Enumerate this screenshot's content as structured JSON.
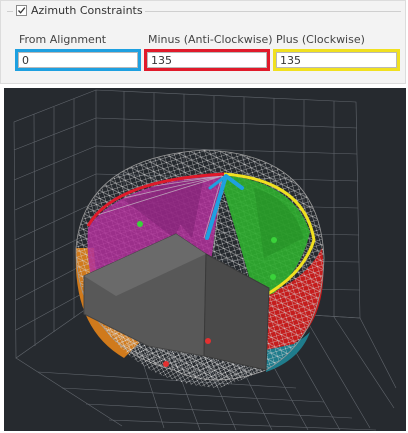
{
  "group": {
    "title": "Azimuth Constraints",
    "checked": true
  },
  "fields": [
    {
      "label": "From Alignment",
      "value": "0",
      "highlight": "#1ea0e0"
    },
    {
      "label": "Minus (Anti-Clockwise)",
      "value": "135",
      "highlight": "#e01a2a"
    },
    {
      "label": "Plus (Clockwise)",
      "value": "135",
      "highlight": "#f0e020"
    }
  ],
  "viewport": {
    "background": "#262a2f",
    "colors": {
      "sphere_mesh": "#bdbdbd",
      "minus_arc": "#e01a2a",
      "plus_arc": "#f0e020",
      "alignment_arrow": "#1ea0e0",
      "minus_region": "#b0309a",
      "plus_region": "#2fae2f",
      "cut_block": "#585858",
      "bowl_band_orange": "#d07a1c",
      "bowl_band_red": "#c51d1d",
      "bowl_band_teal": "#1f7c8c",
      "marker_green": "#3ad33a",
      "marker_red": "#e43030"
    }
  }
}
